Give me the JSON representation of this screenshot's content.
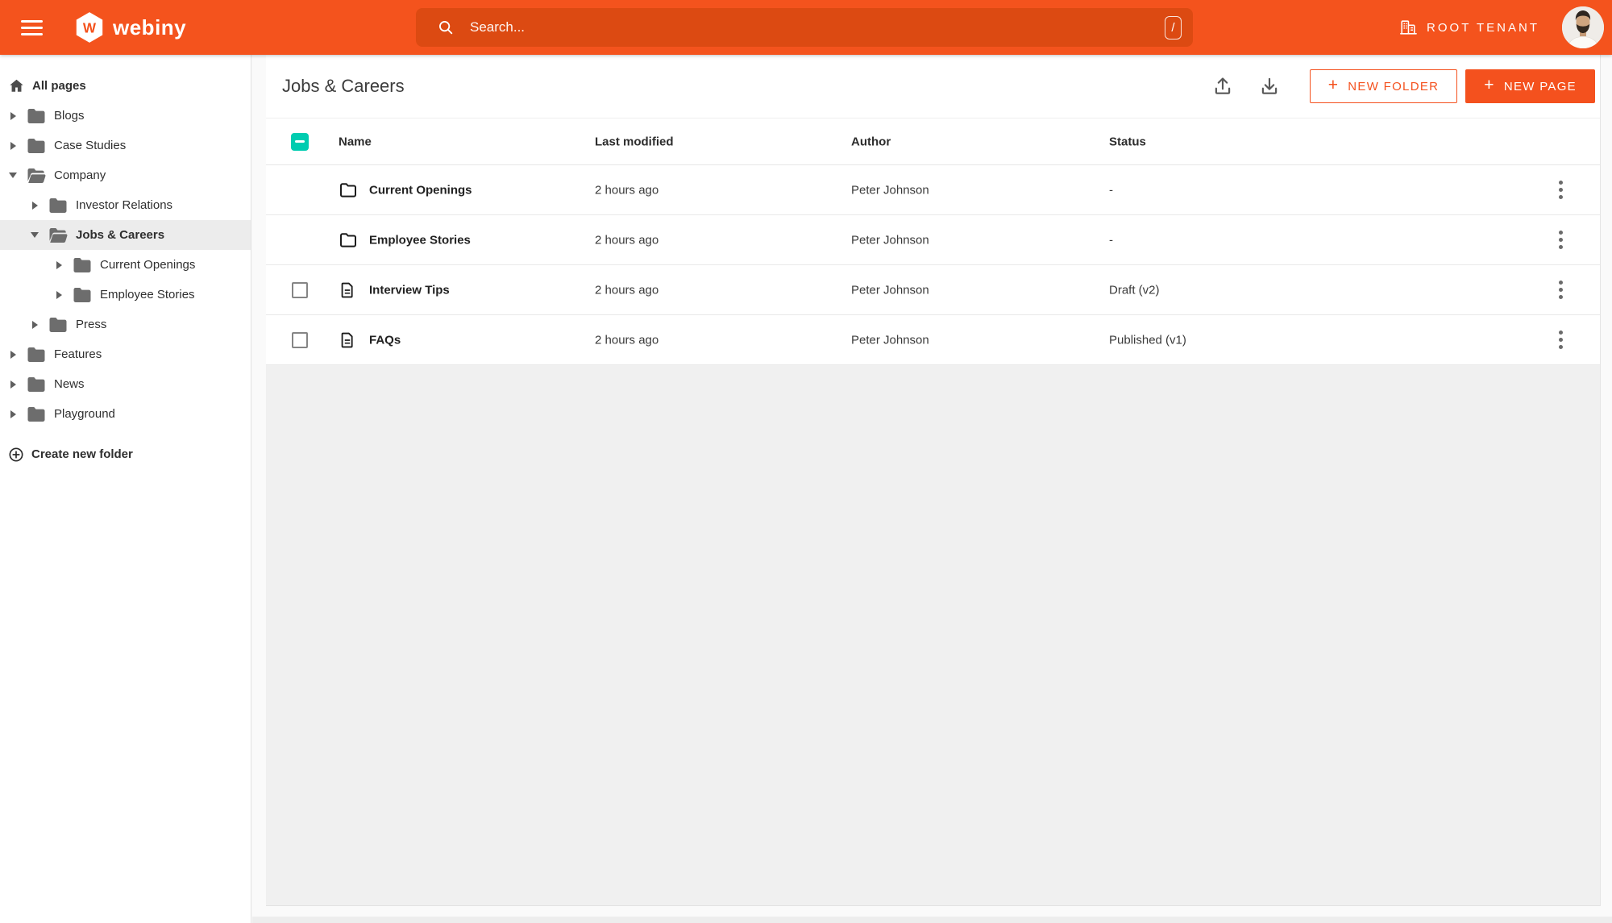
{
  "topbar": {
    "brand": "webiny",
    "logo_letter": "W",
    "search_placeholder": "Search...",
    "search_shortcut": "/",
    "tenant": "ROOT TENANT"
  },
  "sidebar": {
    "all_pages": "All pages",
    "create_folder": "Create new folder",
    "tree": [
      {
        "label": "Blogs",
        "level": 0,
        "state": "collapsed"
      },
      {
        "label": "Case Studies",
        "level": 0,
        "state": "collapsed"
      },
      {
        "label": "Company",
        "level": 0,
        "state": "expanded"
      },
      {
        "label": "Investor Relations",
        "level": 1,
        "state": "collapsed"
      },
      {
        "label": "Jobs & Careers",
        "level": 1,
        "state": "expanded",
        "selected": true
      },
      {
        "label": "Current Openings",
        "level": 2,
        "state": "collapsed"
      },
      {
        "label": "Employee Stories",
        "level": 2,
        "state": "collapsed"
      },
      {
        "label": "Press",
        "level": 1,
        "state": "collapsed"
      },
      {
        "label": "Features",
        "level": 0,
        "state": "collapsed"
      },
      {
        "label": "News",
        "level": 0,
        "state": "collapsed"
      },
      {
        "label": "Playground",
        "level": 0,
        "state": "collapsed"
      }
    ]
  },
  "main": {
    "title": "Jobs & Careers",
    "actions": {
      "plus": "+",
      "new_folder": "NEW FOLDER",
      "new_page": "NEW PAGE"
    },
    "table": {
      "columns": [
        "Name",
        "Last modified",
        "Author",
        "Status"
      ],
      "rows": [
        {
          "type": "folder",
          "name": "Current Openings",
          "last_modified": "2 hours ago",
          "author": "Peter Johnson",
          "status": "-"
        },
        {
          "type": "folder",
          "name": "Employee Stories",
          "last_modified": "2 hours ago",
          "author": "Peter Johnson",
          "status": "-"
        },
        {
          "type": "page",
          "name": "Interview Tips",
          "last_modified": "2 hours ago",
          "author": "Peter Johnson",
          "status": "Draft (v2)"
        },
        {
          "type": "page",
          "name": "FAQs",
          "last_modified": "2 hours ago",
          "author": "Peter Johnson",
          "status": "Published (v1)"
        }
      ]
    }
  },
  "colors": {
    "topbar_orange": "#f4531d",
    "search_orange": "#dc4a12",
    "accent_orange": "#f4511e",
    "checkbox_teal": "#00ccb0"
  }
}
